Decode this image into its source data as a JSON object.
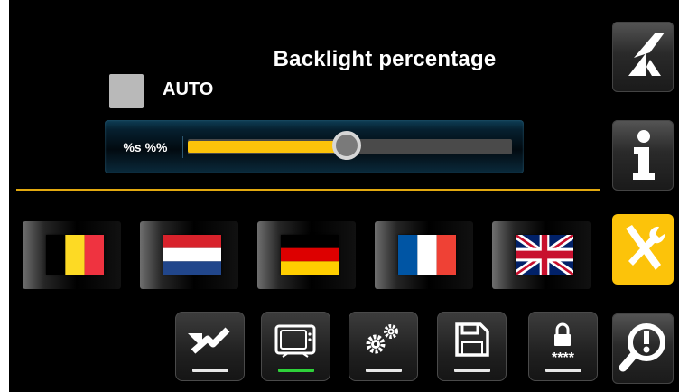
{
  "settings": {
    "title": "Backlight percentage",
    "auto_label": "AUTO",
    "slider_value_label": "%s %%",
    "slider_fraction": 0.49
  },
  "languages": [
    {
      "name": "Belgium",
      "icon": "belgium-flag-icon"
    },
    {
      "name": "Netherlands",
      "icon": "netherlands-flag-icon"
    },
    {
      "name": "Germany",
      "icon": "germany-flag-icon"
    },
    {
      "name": "France",
      "icon": "france-flag-icon"
    },
    {
      "name": "United Kingdom",
      "icon": "uk-flag-icon"
    }
  ],
  "toolbar": [
    {
      "icon": "calibrate-icon",
      "selected": false
    },
    {
      "icon": "display-icon",
      "selected": true
    },
    {
      "icon": "gears-icon",
      "selected": false
    },
    {
      "icon": "save-icon",
      "selected": false
    },
    {
      "icon": "password-lock-icon",
      "password_mask": "****",
      "selected": false
    }
  ],
  "sidebar": [
    {
      "icon": "logo-icon",
      "active": false
    },
    {
      "icon": "info-icon",
      "active": false
    },
    {
      "icon": "tools-icon",
      "active": true
    },
    {
      "icon": "diagnostics-icon",
      "active": false
    }
  ],
  "colors": {
    "accent": "#fcc30a",
    "selected_indicator": "#2ed23a",
    "background": "#000000"
  }
}
